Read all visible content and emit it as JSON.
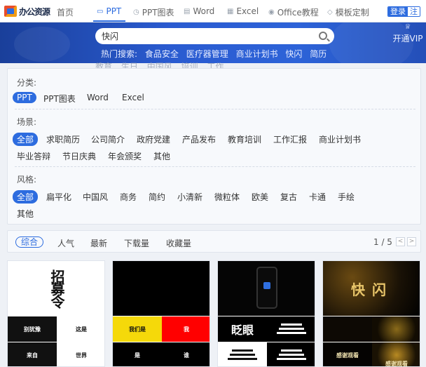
{
  "logo_text": "办公资源",
  "nav": {
    "home": "首页",
    "ppt": "PPT",
    "ppt_chart": "PPT图表",
    "word": "Word",
    "excel": "Excel",
    "office": "Office教程",
    "custom": "模板定制",
    "login": "登录",
    "register": "注"
  },
  "search": {
    "value": "快闪",
    "hot_label": "热门搜索:",
    "hot_terms": [
      "食品安全",
      "医疗器管理",
      "商业计划书",
      "快闪",
      "简历"
    ],
    "hot_terms_row2": [
      "教育",
      "生日",
      "中国风",
      "培训",
      "工作"
    ]
  },
  "vip": {
    "label": "开通VIP"
  },
  "filters": {
    "category": {
      "label": "分类:",
      "options": [
        "PPT",
        "PPT图表",
        "Word",
        "Excel"
      ],
      "selected": "PPT"
    },
    "scene": {
      "label": "场景:",
      "options": [
        "全部",
        "求职简历",
        "公司简介",
        "政府党建",
        "产品发布",
        "教育培训",
        "工作汇报",
        "商业计划书"
      ],
      "options_row2": [
        "毕业答辩",
        "节日庆典",
        "年会颁奖",
        "其他"
      ],
      "selected": "全部"
    },
    "style": {
      "label": "风格:",
      "options": [
        "全部",
        "扁平化",
        "中国风",
        "商务",
        "简约",
        "小清新",
        "微粒体",
        "欧美",
        "复古",
        "卡通",
        "手绘"
      ],
      "options_row2": [
        "其他"
      ],
      "selected": "全部"
    }
  },
  "sort": {
    "options": [
      "综合",
      "人气",
      "最新",
      "下载量",
      "收藏量"
    ],
    "selected": "综合",
    "page": "1 / 5",
    "prev": "<",
    "next": ">"
  },
  "cards": [
    {
      "top_text": "招募令",
      "bl": "别犹豫",
      "br": "这是",
      "b2l": "来自",
      "b2r": "世界"
    },
    {
      "bl": "我们是",
      "br": "我",
      "b2l": "是",
      "b2r": "谁"
    },
    {
      "bl": "眨眼",
      "b2l": "",
      "b2r": ""
    },
    {
      "top_text": "快闪",
      "b2l": "感谢观看",
      "b2r": "感谢观看"
    }
  ]
}
